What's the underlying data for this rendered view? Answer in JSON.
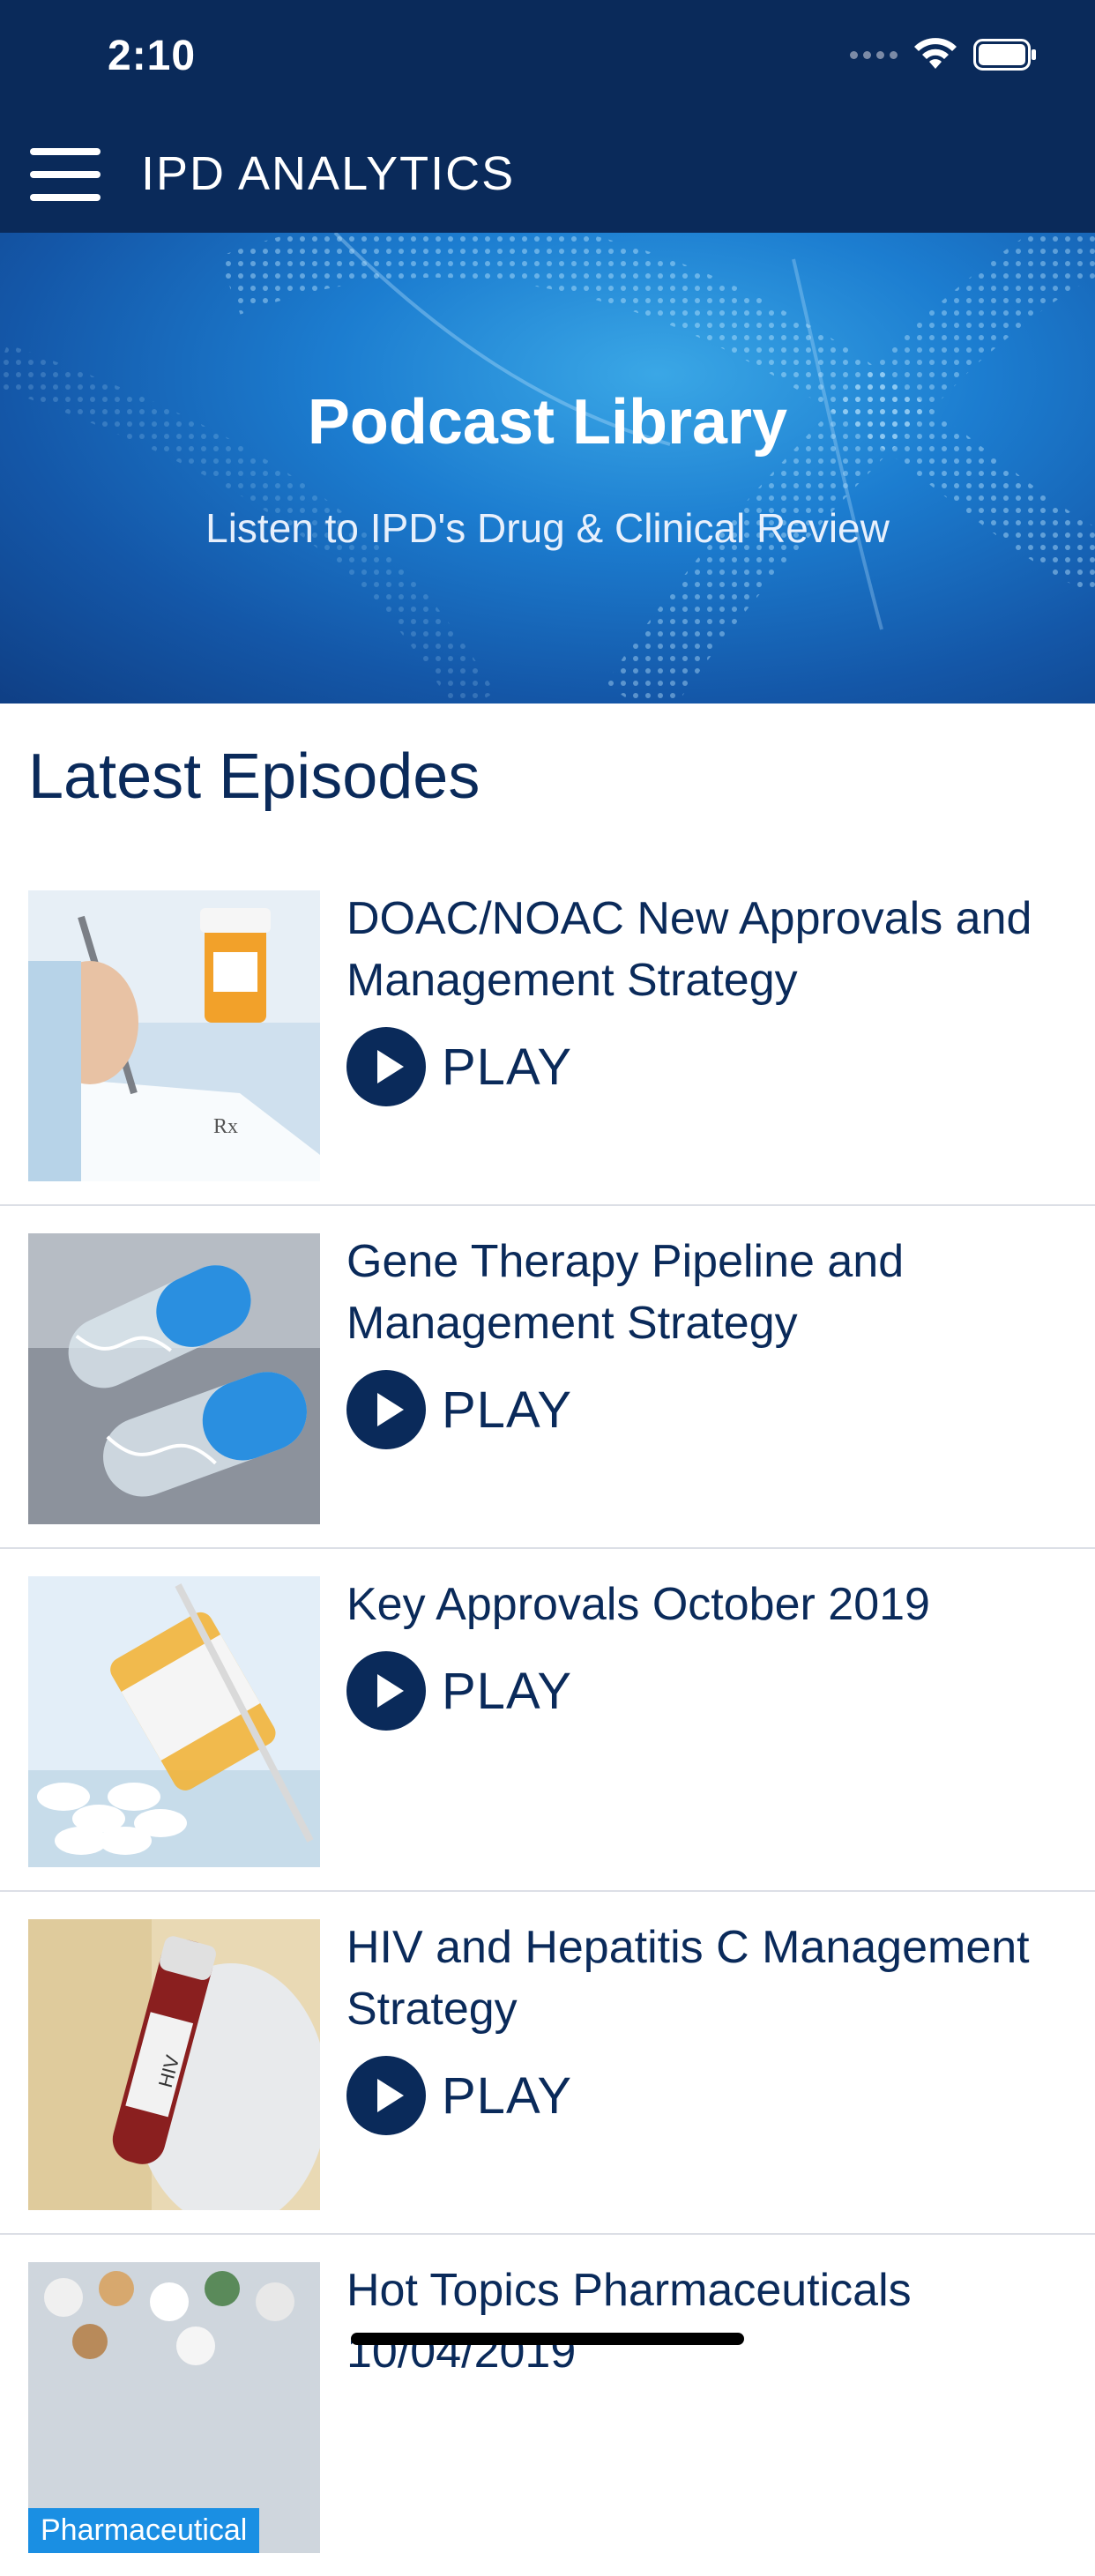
{
  "status_bar": {
    "time": "2:10"
  },
  "header": {
    "title": "IPD ANALYTICS"
  },
  "hero": {
    "title": "Podcast Library",
    "subtitle": "Listen to IPD's Drug & Clinical Review"
  },
  "section": {
    "title": "Latest Episodes"
  },
  "episodes": [
    {
      "title": "DOAC/NOAC New Approvals and Management Strategy",
      "play_label": "PLAY",
      "thumbnail": "prescription-writing-image"
    },
    {
      "title": "Gene Therapy Pipeline and Management Strategy",
      "play_label": "PLAY",
      "thumbnail": "dna-capsules-image"
    },
    {
      "title": "Key Approvals October 2019",
      "play_label": "PLAY",
      "thumbnail": "pill-bottle-syringe-image"
    },
    {
      "title": "HIV and Hepatitis C Management Strategy",
      "play_label": "PLAY",
      "thumbnail": "hiv-blood-tube-image"
    },
    {
      "title": "Hot Topics Pharmaceuticals 10/04/2019",
      "thumbnail": "pharmaceutical-pills-image",
      "tag": "Pharmaceutical"
    }
  ],
  "colors": {
    "primary": "#0a2a5a",
    "accent": "#1a8fe3"
  }
}
